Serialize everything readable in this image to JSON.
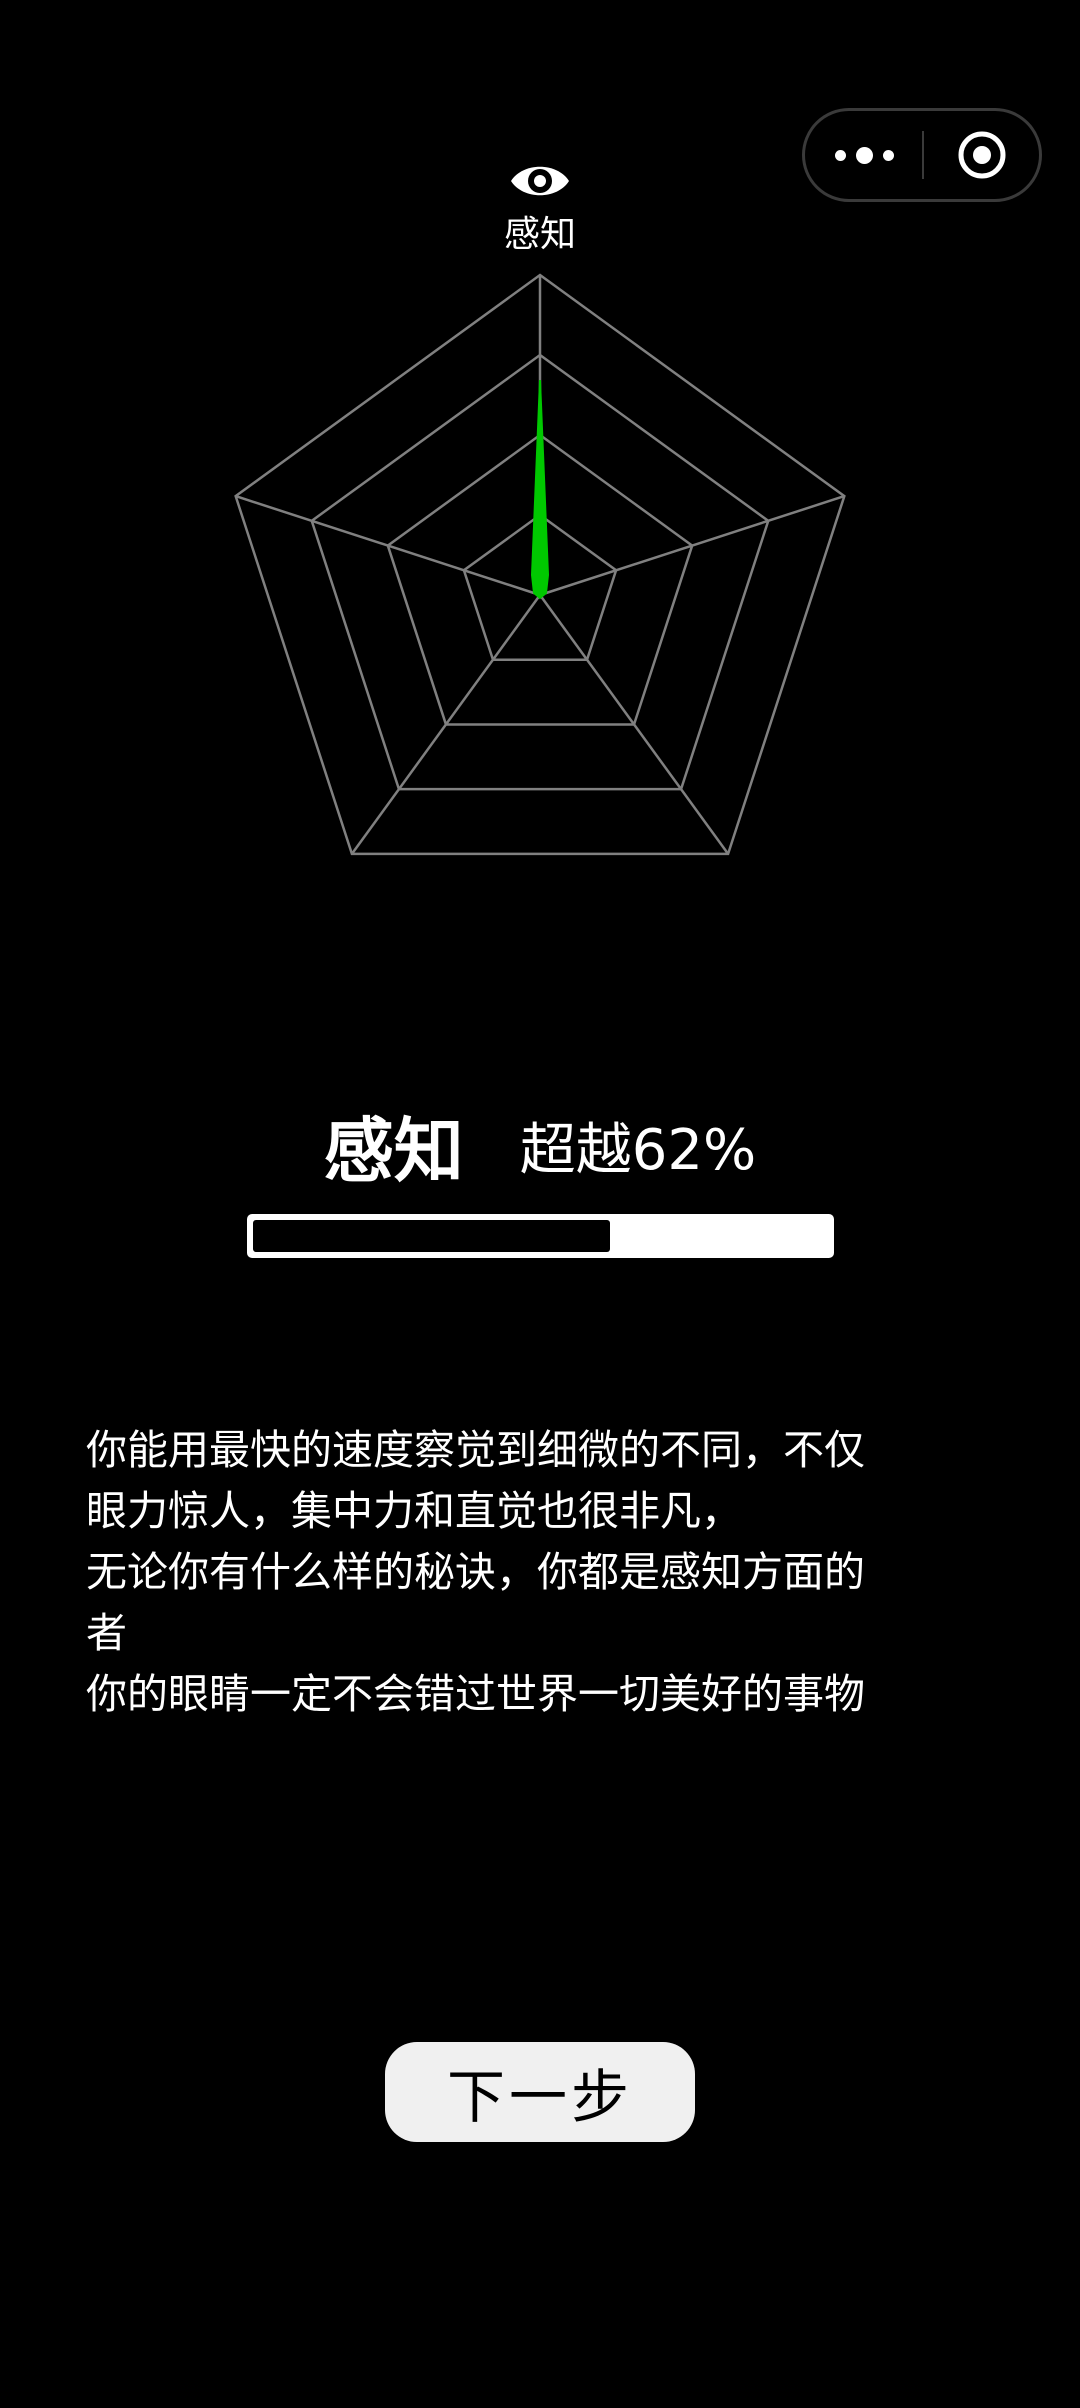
{
  "capsule": {
    "more_icon": "more-dots-icon",
    "close_icon": "target-circle-icon"
  },
  "radar": {
    "axis_label": "感知",
    "axis_icon": "eye-icon",
    "grid_color": "#808080",
    "value_color": "#00c800"
  },
  "result": {
    "category": "感知",
    "percentile_text": "超越62%",
    "progress_fraction": 0.62
  },
  "description": {
    "lines": [
      "你能用最快的速度察觉到细微的不同，不仅",
      "眼力惊人，集中力和直觉也很非凡，",
      "无论你有什么样的秘诀，你都是感知方面的",
      "者",
      "你的眼睛一定不会错过世界一切美好的事物"
    ]
  },
  "next_button": {
    "label": "下一步"
  }
}
